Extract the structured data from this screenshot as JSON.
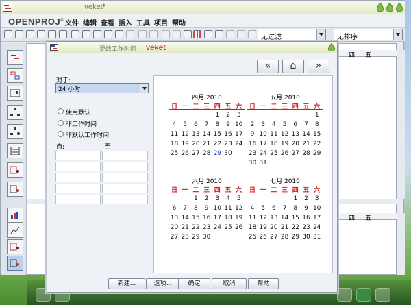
{
  "app": {
    "title": "veket",
    "brand": "OPENPROJ",
    "brand_mark": "®",
    "menu": [
      "文件",
      "编辑",
      "查看",
      "插入",
      "工具",
      "项目",
      "帮助"
    ],
    "filter_combo": "无过滤",
    "sort_combo": "无排序",
    "gantt_days": [
      "四",
      "五"
    ],
    "gantt_days_bottom": [
      "四",
      "五"
    ]
  },
  "dialog": {
    "title": "更改工作时间",
    "project": "veket",
    "nav": {
      "prev": "«",
      "today": "⌂",
      "next": "»"
    },
    "for_label": "对于:",
    "for_value": "24 小时",
    "radios": [
      "使用默认",
      "非工作时间",
      "非默认工作时间"
    ],
    "from_label": "自:",
    "to_label": "至:",
    "buttons": [
      "新建...",
      "选项...",
      "确定",
      "取消",
      "帮助"
    ]
  },
  "calendar": {
    "weekdays": [
      "日",
      "一",
      "二",
      "三",
      "四",
      "五",
      "六"
    ],
    "today": {
      "month": 0,
      "day": 29
    },
    "months": [
      {
        "title": "四月 2010",
        "weeks": [
          [
            "",
            "",
            "",
            "",
            "1",
            "2",
            "3"
          ],
          [
            "4",
            "5",
            "6",
            "7",
            "8",
            "9",
            "10"
          ],
          [
            "11",
            "12",
            "13",
            "14",
            "15",
            "16",
            "17"
          ],
          [
            "18",
            "19",
            "20",
            "21",
            "22",
            "23",
            "24"
          ],
          [
            "25",
            "26",
            "27",
            "28",
            "29",
            "30",
            ""
          ]
        ]
      },
      {
        "title": "五月 2010",
        "weeks": [
          [
            "",
            "",
            "",
            "",
            "",
            "",
            "1"
          ],
          [
            "2",
            "3",
            "4",
            "5",
            "6",
            "7",
            "8"
          ],
          [
            "9",
            "10",
            "11",
            "12",
            "13",
            "14",
            "15"
          ],
          [
            "16",
            "17",
            "18",
            "19",
            "20",
            "21",
            "22"
          ],
          [
            "23",
            "24",
            "25",
            "26",
            "27",
            "28",
            "29"
          ],
          [
            "30",
            "31",
            "",
            "",
            "",
            "",
            ""
          ]
        ]
      },
      {
        "title": "六月 2010",
        "weeks": [
          [
            "",
            "",
            "1",
            "2",
            "3",
            "4",
            "5"
          ],
          [
            "6",
            "7",
            "8",
            "9",
            "10",
            "11",
            "12"
          ],
          [
            "13",
            "14",
            "15",
            "16",
            "17",
            "18",
            "19"
          ],
          [
            "20",
            "21",
            "22",
            "23",
            "24",
            "25",
            "26"
          ],
          [
            "27",
            "28",
            "29",
            "30",
            "",
            "",
            ""
          ]
        ]
      },
      {
        "title": "七月 2010",
        "weeks": [
          [
            "",
            "",
            "",
            "",
            "1",
            "2",
            "3"
          ],
          [
            "4",
            "5",
            "6",
            "7",
            "8",
            "9",
            "10"
          ],
          [
            "11",
            "12",
            "13",
            "14",
            "15",
            "16",
            "17"
          ],
          [
            "18",
            "19",
            "20",
            "21",
            "22",
            "23",
            "24"
          ],
          [
            "25",
            "26",
            "27",
            "28",
            "29",
            "30",
            "31"
          ]
        ]
      }
    ]
  }
}
